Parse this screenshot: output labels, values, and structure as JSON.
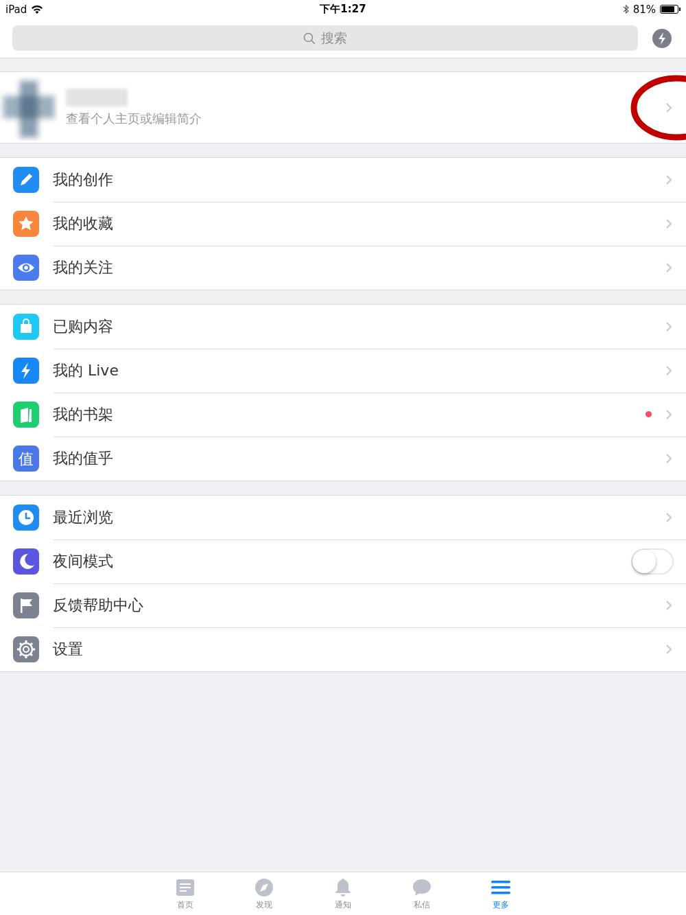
{
  "status_bar": {
    "device": "iPad",
    "time": "下午1:27",
    "battery": "81%"
  },
  "search": {
    "placeholder": "搜索"
  },
  "profile": {
    "subtitle": "查看个人主页或编辑简介"
  },
  "groups": [
    {
      "items": [
        {
          "kind": "link",
          "label": "我的创作",
          "color": "#1e8cf0",
          "unread": false
        },
        {
          "kind": "link",
          "label": "我的收藏",
          "color": "#f7853a",
          "unread": false
        },
        {
          "kind": "link",
          "label": "我的关注",
          "color": "#4a7cf0",
          "unread": false
        }
      ]
    },
    {
      "items": [
        {
          "kind": "link",
          "label": "已购内容",
          "color": "#1ec8f5",
          "unread": false
        },
        {
          "kind": "link",
          "label": "我的 Live",
          "color": "#1588f5",
          "unread": false
        },
        {
          "kind": "link",
          "label": "我的书架",
          "color": "#1dcf70",
          "unread": true
        },
        {
          "kind": "link",
          "label": "我的值乎",
          "color": "#4a78e8",
          "unread": false,
          "icon_text": "值"
        }
      ]
    },
    {
      "items": [
        {
          "kind": "link",
          "label": "最近浏览",
          "color": "#1e8cf0",
          "unread": false
        },
        {
          "kind": "toggle",
          "label": "夜间模式",
          "color": "#5b55e0",
          "on": false
        },
        {
          "kind": "link",
          "label": "反馈帮助中心",
          "color": "#7d8290",
          "unread": false
        },
        {
          "kind": "link",
          "label": "设置",
          "color": "#7d8290",
          "unread": false
        }
      ]
    }
  ],
  "tabs": [
    {
      "label": "首页",
      "selected": false
    },
    {
      "label": "发现",
      "selected": false
    },
    {
      "label": "通知",
      "selected": false
    },
    {
      "label": "私信",
      "selected": false
    },
    {
      "label": "更多",
      "selected": true
    }
  ]
}
